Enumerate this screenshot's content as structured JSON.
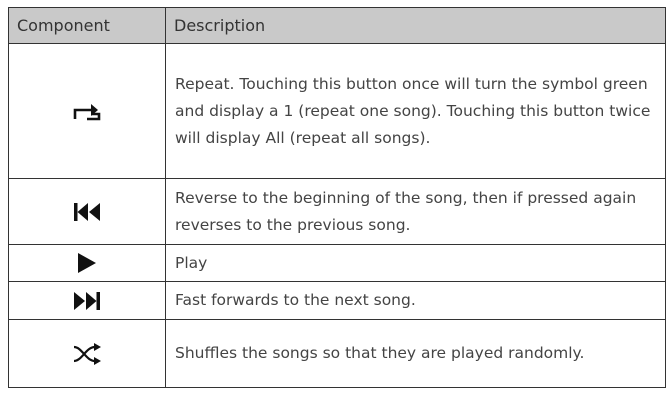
{
  "table": {
    "headers": {
      "component": "Component",
      "description": "Description"
    },
    "rows": [
      {
        "icon": "repeat-icon",
        "description": "Repeat.  Touching this button once will turn the symbol green and display a 1 (repeat one song). Touching this button twice will display All (repeat all songs)."
      },
      {
        "icon": "skip-back-icon",
        "description": "Reverse to the beginning of the song, then if pressed again reverses to the previous song."
      },
      {
        "icon": "play-icon",
        "description": "Play"
      },
      {
        "icon": "skip-forward-icon",
        "description": "Fast forwards to the next song."
      },
      {
        "icon": "shuffle-icon",
        "description": "Shuffles the songs so that they are played randomly."
      }
    ]
  },
  "colors": {
    "header_background": "#c9c9c9",
    "border": "#333333",
    "text": "#444444",
    "icon": "#111111"
  }
}
